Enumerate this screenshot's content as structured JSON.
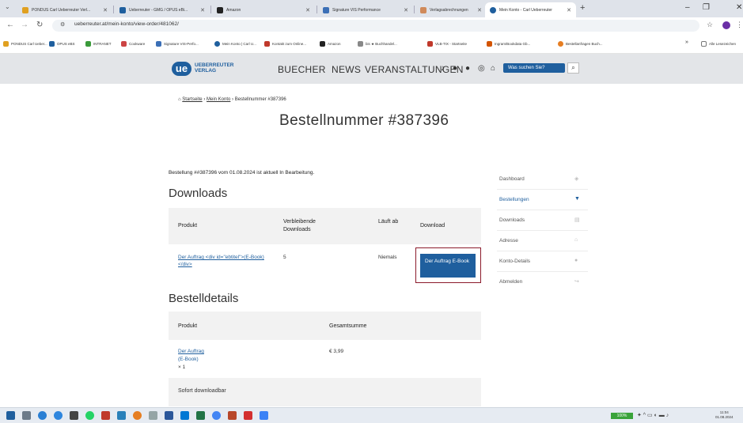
{
  "browser": {
    "tabs": [
      {
        "label": "PONDUS Carl Ueberreuter Verl...",
        "color": "#e0a020"
      },
      {
        "label": "Ueberreuter - GMG / OPUS eBi...",
        "color": "#1f5f9e"
      },
      {
        "label": "Amazon",
        "color": "#222222"
      },
      {
        "label": "Signature VIS Performance",
        "color": "#3b6fb6"
      },
      {
        "label": "Verlagsabrechnungen",
        "color": "#d08a5a"
      },
      {
        "label": "Mein Konto - Carl Ueberreuter",
        "color": "#1f5f9e"
      }
    ],
    "new_tab": "+",
    "window_controls": [
      "–",
      "❐",
      "✕"
    ],
    "url": "ueberreuter.at/mein-konto/view-order/481062/",
    "bookmarks": [
      "PONDUS Carl Ueber...",
      "OPUS eBS",
      "INTRANET",
      "Cookware",
      "Signature VIS-Perfo...",
      "Mein Konto | Carl U...",
      "Kontakt zum Online...",
      "Amazon",
      "bis ★ Buchhandel...",
      "VLB-TIX - Startseite",
      "Ingram/Bookdata Gb...",
      "Bestellanfragen Buch..."
    ],
    "bookmark_overflow": "»",
    "all_bookmarks": "Alle Lesezeichen"
  },
  "site": {
    "logo_mark": "ue",
    "logo_text_1": "UEBERREUTER",
    "logo_text_2": "VERLAG",
    "nav": [
      "BUECHER",
      "NEWS",
      "VERANSTALTUNGEN"
    ],
    "social_icons": [
      "tiktok-icon",
      "pinterest-icon",
      "facebook-icon",
      "instagram-icon",
      "shop-icon"
    ],
    "search_label": "Was suchen Sie?",
    "search_icon": "search-icon"
  },
  "breadcrumb": {
    "home": "Startseite",
    "sep": " › ",
    "account": "Mein Konto",
    "current": "Bestellnummer #387396"
  },
  "page_title": "Bestellnummer #387396",
  "order_status": "Bestellung ##387396 vom 01.08.2024 ist aktuell In Bearbeitung.",
  "downloads": {
    "heading": "Downloads",
    "col_product": "Produkt",
    "col_remaining": "Verbleibende Downloads",
    "col_expires": "Läuft ab",
    "col_download": "Download",
    "row": {
      "product": "Der Auftrag <div id=\"ebtitel\">(E-Book)</div>",
      "remaining": "5",
      "expires": "Niemals",
      "button": "Der Auftrag E-Book"
    }
  },
  "details": {
    "heading": "Bestelldetails",
    "col_product": "Produkt",
    "col_total": "Gesamtsumme",
    "row_product": "Der Auftrag",
    "row_variant": "(E-Book)",
    "row_qty": "× 1",
    "row_total": "€ 3,99",
    "footer_note": "Sofort downloadbar"
  },
  "sidebar": [
    {
      "label": "Dashboard",
      "icon": "dashboard-icon",
      "active": false
    },
    {
      "label": "Bestellungen",
      "icon": "basket-icon",
      "active": true
    },
    {
      "label": "Downloads",
      "icon": "file-icon",
      "active": false
    },
    {
      "label": "Adresse",
      "icon": "home-icon",
      "active": false
    },
    {
      "label": "Konto-Details",
      "icon": "user-icon",
      "active": false
    },
    {
      "label": "Abmelden",
      "icon": "logout-icon",
      "active": false
    }
  ],
  "taskbar": {
    "battery": "100%",
    "time": "11:04",
    "date": "01.08.2024"
  }
}
